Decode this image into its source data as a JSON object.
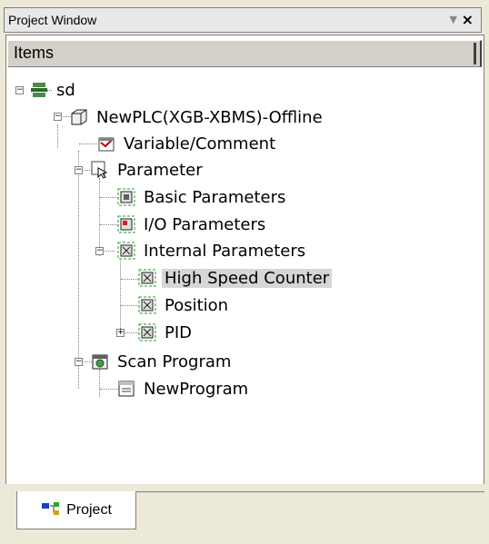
{
  "window": {
    "title": "Project Window"
  },
  "header": {
    "items_label": "Items"
  },
  "tree": {
    "root": "sd",
    "plc": "NewPLC(XGB-XBMS)-Offline",
    "variable": "Variable/Comment",
    "parameter": "Parameter",
    "basic": "Basic Parameters",
    "io": "I/O Parameters",
    "internal": "Internal Parameters",
    "hsc": "High Speed Counter",
    "position": "Position",
    "pid": "PID",
    "scan": "Scan Program",
    "program": "NewProgram"
  },
  "tabs": {
    "project": "Project"
  }
}
